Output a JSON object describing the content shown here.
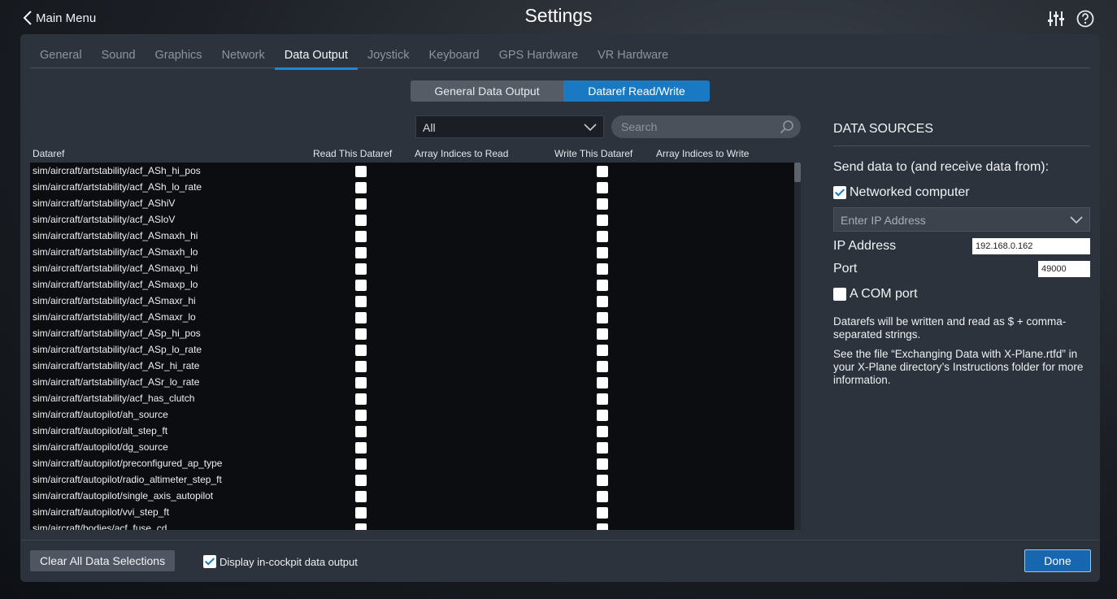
{
  "topbar": {
    "back_label": "Main Menu",
    "title": "Settings"
  },
  "tabs": [
    {
      "label": "General"
    },
    {
      "label": "Sound"
    },
    {
      "label": "Graphics"
    },
    {
      "label": "Network"
    },
    {
      "label": "Data Output"
    },
    {
      "label": "Joystick"
    },
    {
      "label": "Keyboard"
    },
    {
      "label": "GPS Hardware"
    },
    {
      "label": "VR Hardware"
    }
  ],
  "active_tab": "Data Output",
  "segment": {
    "left_label": "General Data Output",
    "right_label": "Dataref Read/Write",
    "selected": "Dataref Read/Write"
  },
  "filter": {
    "value": "All"
  },
  "search": {
    "placeholder": "Search"
  },
  "table": {
    "headers": {
      "dataref": "Dataref",
      "read": "Read This Dataref",
      "read_indices": "Array Indices to Read",
      "write": "Write This Dataref",
      "write_indices": "Array Indices to Write"
    },
    "rows": [
      "sim/aircraft/artstability/acf_ASh_hi_pos",
      "sim/aircraft/artstability/acf_ASh_lo_rate",
      "sim/aircraft/artstability/acf_AShiV",
      "sim/aircraft/artstability/acf_ASloV",
      "sim/aircraft/artstability/acf_ASmaxh_hi",
      "sim/aircraft/artstability/acf_ASmaxh_lo",
      "sim/aircraft/artstability/acf_ASmaxp_hi",
      "sim/aircraft/artstability/acf_ASmaxp_lo",
      "sim/aircraft/artstability/acf_ASmaxr_hi",
      "sim/aircraft/artstability/acf_ASmaxr_lo",
      "sim/aircraft/artstability/acf_ASp_hi_pos",
      "sim/aircraft/artstability/acf_ASp_lo_rate",
      "sim/aircraft/artstability/acf_ASr_hi_rate",
      "sim/aircraft/artstability/acf_ASr_lo_rate",
      "sim/aircraft/artstability/acf_has_clutch",
      "sim/aircraft/autopilot/ah_source",
      "sim/aircraft/autopilot/alt_step_ft",
      "sim/aircraft/autopilot/dg_source",
      "sim/aircraft/autopilot/preconfigured_ap_type",
      "sim/aircraft/autopilot/radio_altimeter_step_ft",
      "sim/aircraft/autopilot/single_axis_autopilot",
      "sim/aircraft/autopilot/vvi_step_ft",
      "sim/aircraft/bodies/acf_fuse_cd"
    ]
  },
  "data_sources": {
    "title": "DATA SOURCES",
    "send_label": "Send data to (and receive data from):",
    "networked_label": "Networked computer",
    "networked_checked": true,
    "ip_select_placeholder": "Enter IP Address",
    "ip_label": "IP Address",
    "ip_value": "192.168.0.162",
    "port_label": "Port",
    "port_value": "49000",
    "com_label": "A COM port",
    "com_checked": false,
    "note1": "Datarefs will be written and read as $ + comma-separated strings.",
    "note2": "See the file “Exchanging Data with X-Plane.rtfd” in your X-Plane directory’s Instructions folder for more information."
  },
  "bottom": {
    "clear_label": "Clear All Data Selections",
    "cockpit_label": "Display in-cockpit data output",
    "cockpit_checked": true,
    "done_label": "Done"
  },
  "colors": {
    "accent": "#1979c2",
    "panel": "#2c333c",
    "table_bg": "#0b0d10"
  }
}
